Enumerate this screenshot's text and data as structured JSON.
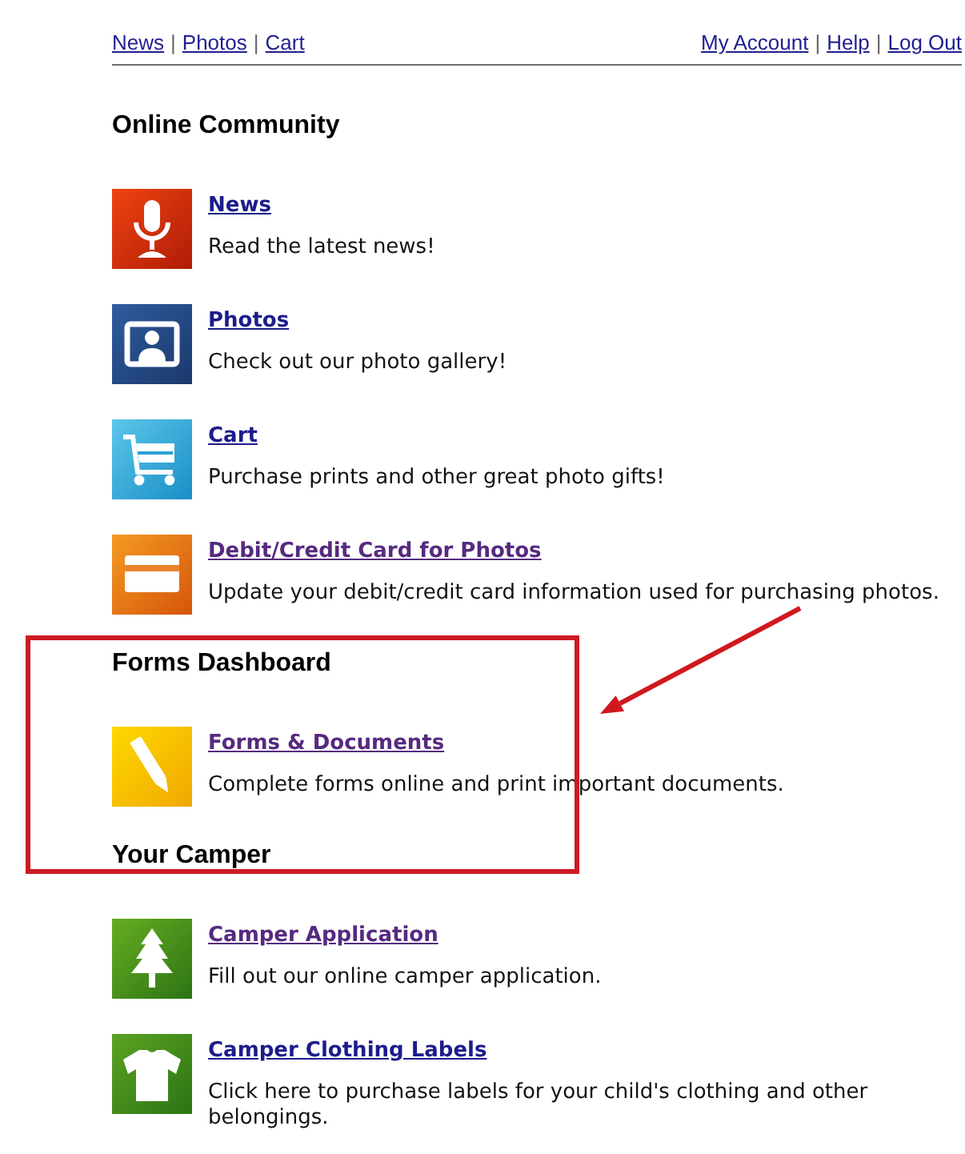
{
  "top_nav": {
    "left": [
      {
        "kind": "link",
        "text": "News"
      },
      {
        "kind": "separator",
        "text": "|"
      },
      {
        "kind": "link",
        "text": "Photos"
      },
      {
        "kind": "separator",
        "text": "|"
      },
      {
        "kind": "link",
        "text": "Cart"
      }
    ],
    "right": [
      {
        "kind": "link",
        "text": "My Account"
      },
      {
        "kind": "separator",
        "text": "|"
      },
      {
        "kind": "link",
        "text": "Help"
      },
      {
        "kind": "separator",
        "text": "|"
      },
      {
        "kind": "link",
        "text": "Log Out"
      }
    ]
  },
  "sections": [
    {
      "heading": "Online Community",
      "items": [
        {
          "title": "News",
          "description": "Read the latest news!",
          "visited": false
        },
        {
          "title": "Photos",
          "description": "Check out our photo gallery!",
          "visited": false
        },
        {
          "title": "Cart",
          "description": "Purchase prints and other great photo gifts!",
          "visited": false
        },
        {
          "title": "Debit/Credit Card for Photos",
          "description": "Update your debit/credit card information used for purchasing photos.",
          "visited": true
        }
      ]
    },
    {
      "heading": "Forms Dashboard",
      "items": [
        {
          "title": "Forms & Documents",
          "description": "Complete forms online and print important documents.",
          "visited": true
        }
      ]
    },
    {
      "heading": "Your Camper",
      "items": [
        {
          "title": "Camper Application",
          "description": "Fill out our online camper application.",
          "visited": true
        },
        {
          "title": "Camper Clothing Labels",
          "description": "Click here to purchase labels for your child's clothing and other belongings.",
          "visited": false
        }
      ]
    }
  ]
}
